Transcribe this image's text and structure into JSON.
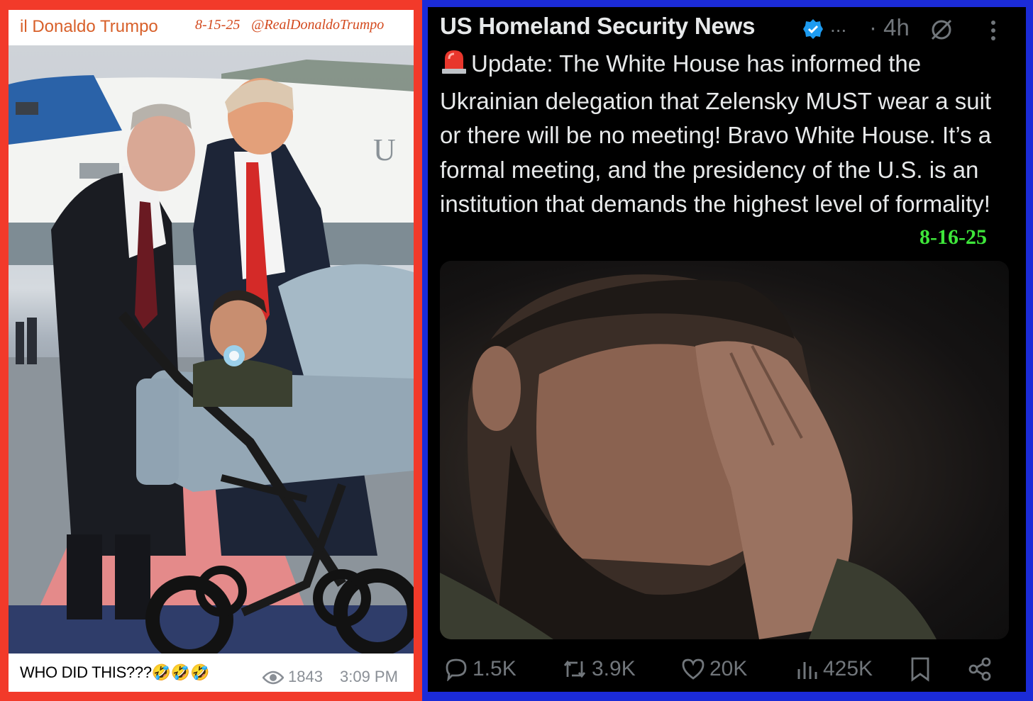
{
  "telegram_post": {
    "channel_name": "il Donaldo Trumpo",
    "date": "8-15-25",
    "handle": "@RealDonaldoTrumpo",
    "caption": "WHO DID THIS???",
    "caption_emojis": "🤣🤣🤣",
    "views": "1843",
    "time": "3:09 PM",
    "plane_letters": "U"
  },
  "tweet": {
    "account_name": "US Homeland Security News",
    "ellipsis": "...",
    "age": "· 4h",
    "text": "Update: The White House has informed the Ukrainian delegation that Zelensky MUST wear a suit or there will be no meeting! Bravo White House. It’s a formal meeting, and the presidency of the U.S. is an institution that demands the highest level of formality!",
    "overlay_date": "8-16-25",
    "replies": "1.5K",
    "reposts": "3.9K",
    "likes": "20K",
    "views": "425K"
  },
  "colors": {
    "left_frame": "#f23a2a",
    "right_frame": "#1b2bd8",
    "verified_blue": "#1d9bf0",
    "overlay_green": "#3ee63a"
  },
  "icons": [
    "siren-icon",
    "verified-icon",
    "grok-icon",
    "more-icon",
    "eye-icon",
    "reply-icon",
    "repost-icon",
    "like-icon",
    "views-icon",
    "bookmark-icon",
    "share-icon"
  ]
}
